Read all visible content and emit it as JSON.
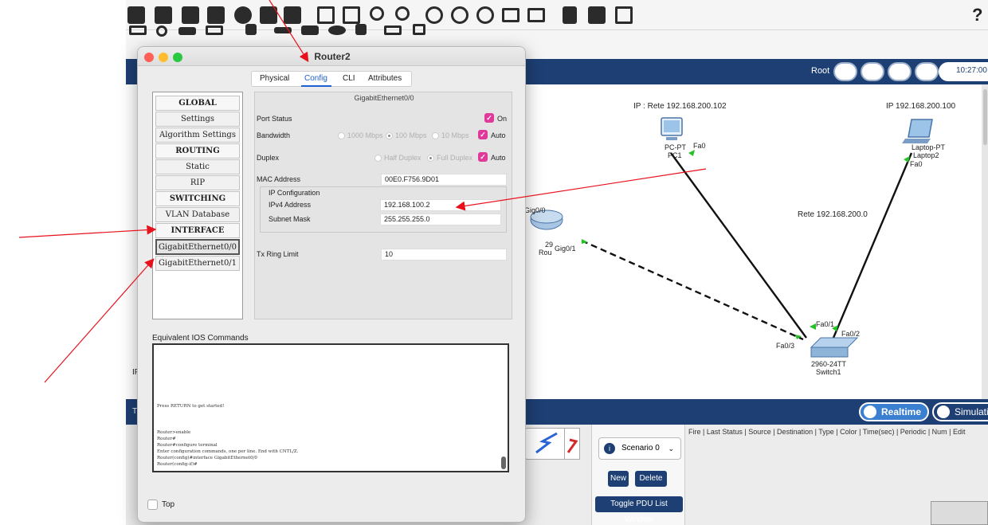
{
  "app": {
    "help_label": "?",
    "root_label": "Root",
    "clock": "10:27:00",
    "mode_realtime": "Realtime",
    "mode_simulation": "Simulation",
    "scenario": "Scenario 0",
    "scenario_caret": "⌄",
    "scenario_info": "i",
    "btn_new": "New",
    "btn_delete": "Delete",
    "btn_toggle_pdu": "Toggle PDU List Window",
    "pdu_columns": "Fire  |  Last Status  |  Source  |  Destination  |  Type  |  Color  |  Time(sec)  |  Periodic  |  Num  |  Edit",
    "side_labels": {
      "ip": "IP",
      "t": "T"
    }
  },
  "topology": {
    "pc_ip_label": "IP : Rete 192.168.200.102",
    "laptop_ip_label": "IP 192.168.200.100",
    "pc_model": "PC-PT",
    "pc_name": "PC1",
    "pc_port": "Fa0",
    "laptop_model": "Laptop-PT",
    "laptop_name": "Laptop2",
    "laptop_port": "Fa0",
    "network_label": "Rete 192.168.200.0",
    "router_model": "29",
    "router_name": "Rou",
    "router_gig00": "Gig0/0",
    "router_gig01": "Gig0/1",
    "switch_fa01": "Fa0/1",
    "switch_fa02": "Fa0/2",
    "switch_fa03": "Fa0/3",
    "switch_model": "2960-24TT",
    "switch_name": "Switch1"
  },
  "dialog": {
    "title": "Router2",
    "tabs": [
      "Physical",
      "Config",
      "CLI",
      "Attributes"
    ],
    "active_tab": "Config",
    "nav": [
      {
        "label": "GLOBAL",
        "head": true
      },
      {
        "label": "Settings"
      },
      {
        "label": "Algorithm Settings"
      },
      {
        "label": "ROUTING",
        "head": true
      },
      {
        "label": "Static"
      },
      {
        "label": "RIP"
      },
      {
        "label": "SWITCHING",
        "head": true
      },
      {
        "label": "VLAN Database"
      },
      {
        "label": "INTERFACE",
        "head": true
      },
      {
        "label": "GigabitEthernet0/0",
        "selected": true
      },
      {
        "label": "GigabitEthernet0/1"
      }
    ],
    "panel_title": "GigabitEthernet0/0",
    "port_status_label": "Port Status",
    "port_status_on": "On",
    "bandwidth_label": "Bandwidth",
    "bw_1000": "1000 Mbps",
    "bw_100": "100 Mbps",
    "bw_10": "10 Mbps",
    "bw_auto": "Auto",
    "duplex_label": "Duplex",
    "duplex_half": "Half Duplex",
    "duplex_full": "Full Duplex",
    "duplex_auto": "Auto",
    "mac_label": "MAC Address",
    "mac_value": "00E0.F756.9D01",
    "ip_config_label": "IP Configuration",
    "ipv4_label": "IPv4 Address",
    "ipv4_value": "192.168.100.2",
    "mask_label": "Subnet Mask",
    "mask_value": "255.255.255.0",
    "tx_label": "Tx Ring Limit",
    "tx_value": "10",
    "ios_label": "Equivalent IOS Commands",
    "console": [
      "Press RETURN to get started!",
      "Router>enable",
      "Router#",
      "Router#configure terminal",
      "Enter configuration commands, one per line.  End with CNTL/Z.",
      "Router(config)#interface GigabitEthernet0/0",
      "Router(config-if)#"
    ],
    "top_label": "Top",
    "check_mark": "✓"
  },
  "colors": {
    "accent_blue": "#1e3f73",
    "check_pink": "#e0399a",
    "annotation_red": "#e8101a"
  }
}
